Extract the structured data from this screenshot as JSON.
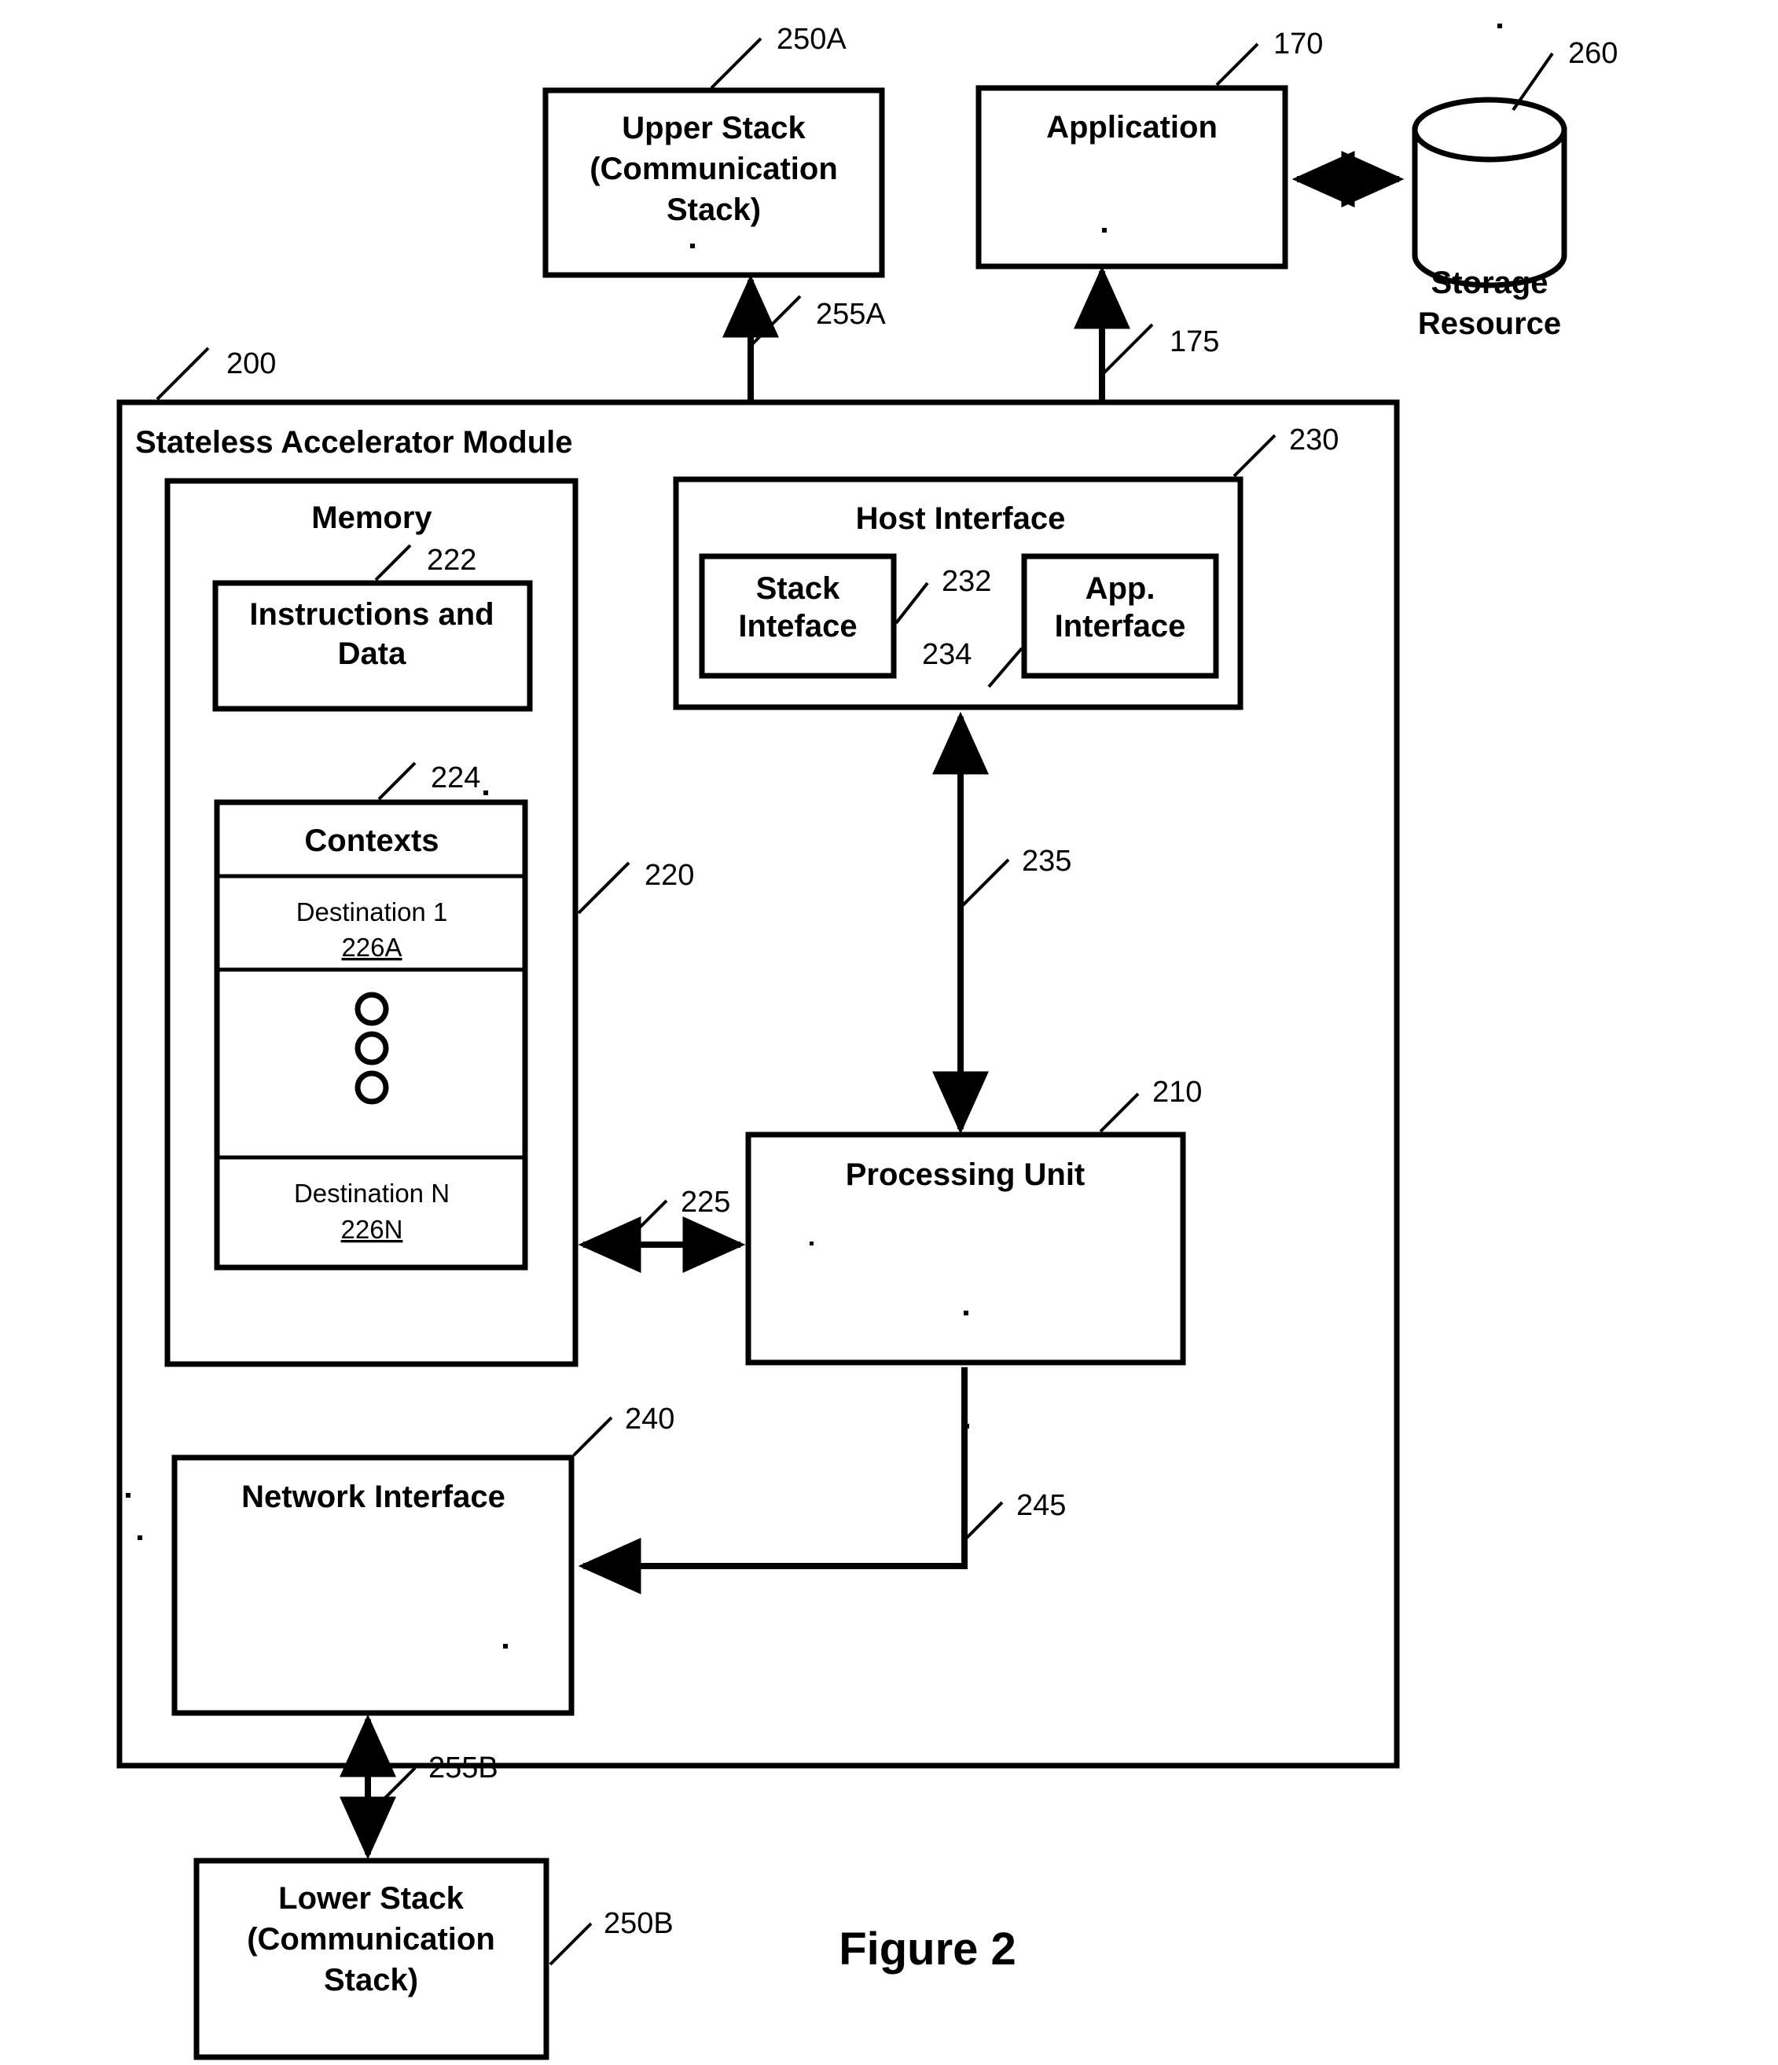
{
  "figure": {
    "caption": "Figure 2"
  },
  "blocks": {
    "upper_stack": {
      "line1": "Upper Stack",
      "line2": "(Communication",
      "line3": "Stack)",
      "ref": "250A"
    },
    "application": {
      "label": "Application",
      "ref": "170"
    },
    "storage_resource": {
      "line1": "Storage",
      "line2": "Resource",
      "ref": "260"
    },
    "module": {
      "label": "Stateless Accelerator Module",
      "ref": "200"
    },
    "memory": {
      "label": "Memory",
      "ref": "220"
    },
    "instructions_and_data": {
      "line1": "Instructions and",
      "line2": "Data",
      "ref": "222"
    },
    "contexts": {
      "label": "Contexts",
      "ref": "224",
      "rows": [
        {
          "label": "Destination 1",
          "ref": "226A"
        },
        {
          "label": "Destination N",
          "ref": "226N"
        }
      ],
      "ellipsis_marker": "three-circles"
    },
    "host_interface": {
      "label": "Host Interface",
      "ref": "230"
    },
    "stack_interface": {
      "line1": "Stack",
      "line2": "Inteface",
      "ref": "232"
    },
    "app_interface": {
      "line1": "App.",
      "line2": "Interface",
      "ref": "234"
    },
    "processing_unit": {
      "label": "Processing Unit",
      "ref": "210"
    },
    "network_interface": {
      "label": "Network Interface",
      "ref": "240"
    },
    "lower_stack": {
      "line1": "Lower Stack",
      "line2": "(Communication",
      "line3": "Stack)",
      "ref": "250B"
    }
  },
  "connectors": {
    "upper_stack_to_stack_interface": {
      "ref": "255A",
      "type": "double-arrow"
    },
    "application_to_app_interface": {
      "ref": "175",
      "type": "double-arrow"
    },
    "application_to_storage": {
      "ref": "",
      "type": "double-arrow"
    },
    "host_interface_to_processing_unit": {
      "ref": "235",
      "type": "double-arrow"
    },
    "memory_to_processing_unit": {
      "ref": "225",
      "type": "double-arrow"
    },
    "processing_unit_to_network_interface": {
      "ref": "245",
      "type": "single-arrow"
    },
    "network_interface_to_lower_stack": {
      "ref": "255B",
      "type": "double-arrow"
    }
  },
  "colors": {
    "ink": "#000000",
    "paper": "#ffffff"
  }
}
